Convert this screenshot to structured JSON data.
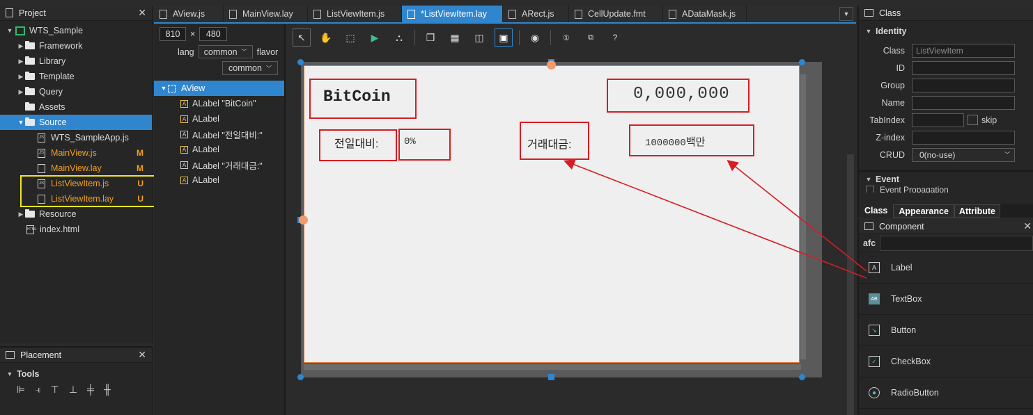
{
  "project": {
    "title": "Project",
    "root": "WTS_Sample",
    "items": [
      {
        "label": "Framework",
        "type": "folder",
        "level": 1,
        "expand": true
      },
      {
        "label": "Library",
        "type": "folder",
        "level": 1,
        "expand": true
      },
      {
        "label": "Template",
        "type": "folder",
        "level": 1,
        "expand": true
      },
      {
        "label": "Query",
        "type": "folder",
        "level": 1,
        "expand": true
      },
      {
        "label": "Assets",
        "type": "folder",
        "level": 1,
        "expand": false
      },
      {
        "label": "Source",
        "type": "folder",
        "level": 1,
        "expand": true,
        "selected": true
      },
      {
        "label": "WTS_SampleApp.js",
        "type": "file",
        "level": 2,
        "badge": ""
      },
      {
        "label": "MainView.js",
        "type": "file",
        "level": 2,
        "badge": "M",
        "modified": true
      },
      {
        "label": "MainView.lay",
        "type": "file",
        "level": 2,
        "badge": "M",
        "modified": true
      },
      {
        "label": "ListViewItem.js",
        "type": "file",
        "level": 2,
        "badge": "U",
        "modified": true
      },
      {
        "label": "ListViewItem.lay",
        "type": "file",
        "level": 2,
        "badge": "U",
        "modified": true
      },
      {
        "label": "Resource",
        "type": "folder",
        "level": 1,
        "expand": true
      },
      {
        "label": "index.html",
        "type": "html",
        "level": 1,
        "badge": ""
      }
    ]
  },
  "placement": {
    "title": "Placement",
    "tools_label": "Tools"
  },
  "tabs": [
    {
      "label": "AView.js"
    },
    {
      "label": "MainView.lay"
    },
    {
      "label": "ListViewItem.js"
    },
    {
      "label": "*ListViewItem.lay",
      "active": true
    },
    {
      "label": "ARect.js"
    },
    {
      "label": "CellUpdate.fmt"
    },
    {
      "label": "ADataMask.js"
    }
  ],
  "size": {
    "width": "810",
    "x": "×",
    "height": "480"
  },
  "lang": {
    "label": "lang",
    "value": "common",
    "flavor_label": "flavor",
    "flavor_value": "common"
  },
  "outline": {
    "root": "AView",
    "items": [
      "ALabel \"BitCoin\"",
      "ALabel",
      "ALabel \"전일대비:\"",
      "ALabel",
      "ALabel \"거래대금:\"",
      "ALabel"
    ]
  },
  "canvas": {
    "title_text": "BitCoin",
    "price_text": "0,000,000",
    "prev_label": "전일대비:",
    "prev_value": "0%",
    "volume_label": "거래대금:",
    "volume_value": "1000000",
    "volume_unit": "백만"
  },
  "class_panel": {
    "title": "Class",
    "identity": "Identity",
    "class_label": "Class",
    "class_value": "ListViewItem",
    "id_label": "ID",
    "group_label": "Group",
    "name_label": "Name",
    "tabindex_label": "TabIndex",
    "skip_label": "skip",
    "zindex_label": "Z-index",
    "crud_label": "CRUD",
    "crud_value": "0(no-use)",
    "event": "Event",
    "event_prop": "Event Propagation",
    "tabs": [
      "Class",
      "Appearance",
      "Attribute"
    ]
  },
  "component": {
    "title": "Component",
    "filter_label": "afc",
    "items": [
      {
        "label": "Label",
        "icon": "label-icon"
      },
      {
        "label": "TextBox",
        "icon": "textbox-icon"
      },
      {
        "label": "Button",
        "icon": "button-icon"
      },
      {
        "label": "CheckBox",
        "icon": "checkbox-icon"
      },
      {
        "label": "RadioButton",
        "icon": "radiobutton-icon"
      }
    ]
  },
  "colors": {
    "accent": "#2f86cf",
    "annotation": "#d81b24",
    "modified": "#f0a020",
    "highlight": "#f2e61e"
  }
}
